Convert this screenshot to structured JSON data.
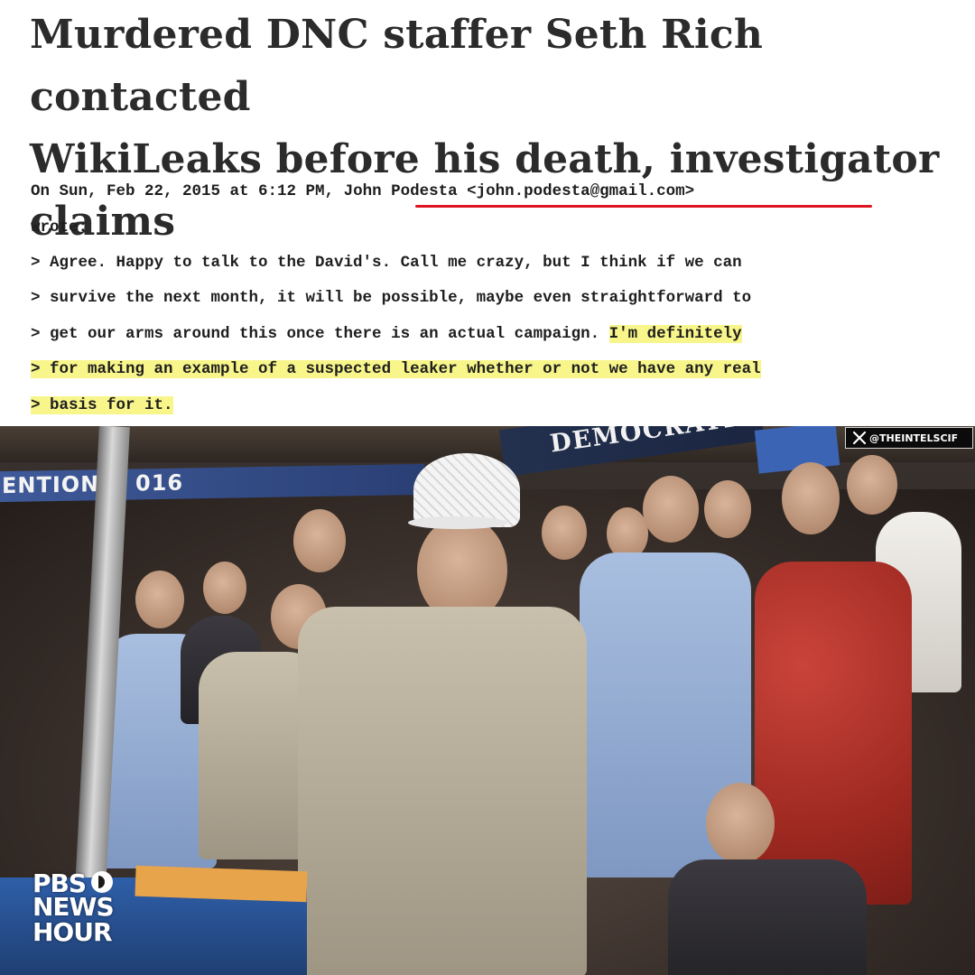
{
  "article": {
    "headline_lines": [
      "Murdered DNC staffer Seth Rich contacted",
      "WikiLeaks before his death, investigator",
      "claims"
    ]
  },
  "email": {
    "header_date": "On Sun, Feb 22, 2015 at 6:12 PM, ",
    "header_sender": "John Podesta <john.podesta@gmail.com>",
    "wrote": "wrote:",
    "quoted_lines": [
      "> Agree. Happy to talk to the David's. Call me crazy, but I think if we can",
      "> survive the next month, it will be possible, maybe even straightforward to",
      "> get our arms around this once there is an actual campaign. "
    ],
    "highlighted_1": "I'm definitely",
    "highlighted_2": "> for making an example of a suspected leaker whether or not we have any real",
    "highlighted_3": "> basis for it.",
    "underline_color": "#e0141f",
    "highlight_color": "#f8f68a"
  },
  "video": {
    "banner_left": "ENTION",
    "banner_left_year": "016",
    "banner_right": "DEMOCRATI",
    "watermark_handle": "@THEINTELSCIF",
    "watermark_icon": "x-logo-icon",
    "broadcaster": {
      "line1": "PBS",
      "line2": "NEWS",
      "line3": "HOUR",
      "logo_icon": "pbs-head-icon"
    }
  }
}
